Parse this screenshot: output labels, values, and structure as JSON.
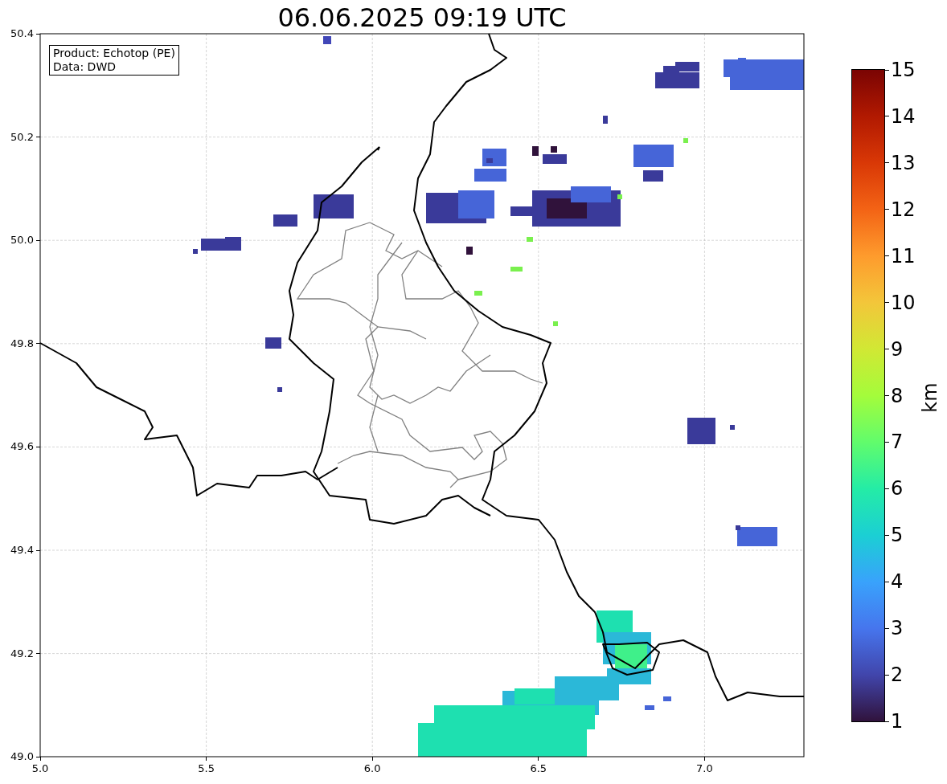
{
  "title": "06.06.2025 09:19 UTC",
  "legend": [
    "Product: Echotop (PE)",
    "Data: DWD"
  ],
  "x_ticks": [
    "5.0",
    "5.5",
    "6.0",
    "6.5",
    "7.0"
  ],
  "y_ticks": [
    "50.4",
    "50.2",
    "50.0",
    "49.8",
    "49.6",
    "49.4",
    "49.2",
    "49.0"
  ],
  "colorbar": {
    "label": "km",
    "ticks": [
      "15",
      "14",
      "13",
      "12",
      "11",
      "10",
      "9",
      "8",
      "7",
      "6",
      "5",
      "4",
      "3",
      "2",
      "1"
    ]
  }
}
